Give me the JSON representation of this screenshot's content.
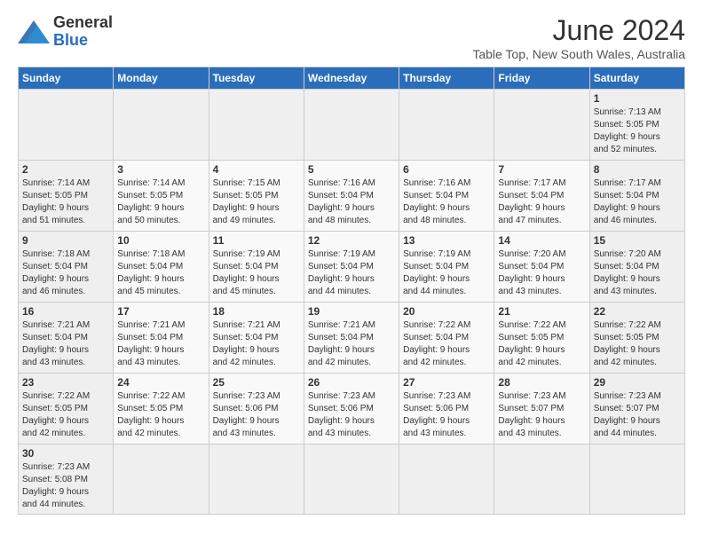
{
  "header": {
    "logo_general": "General",
    "logo_blue": "Blue",
    "month": "June 2024",
    "location": "Table Top, New South Wales, Australia"
  },
  "days_of_week": [
    "Sunday",
    "Monday",
    "Tuesday",
    "Wednesday",
    "Thursday",
    "Friday",
    "Saturday"
  ],
  "weeks": [
    [
      {
        "day": "",
        "info": ""
      },
      {
        "day": "",
        "info": ""
      },
      {
        "day": "",
        "info": ""
      },
      {
        "day": "",
        "info": ""
      },
      {
        "day": "",
        "info": ""
      },
      {
        "day": "",
        "info": ""
      },
      {
        "day": "1",
        "info": "Sunrise: 7:13 AM\nSunset: 5:05 PM\nDaylight: 9 hours\nand 52 minutes."
      }
    ],
    [
      {
        "day": "2",
        "info": "Sunrise: 7:14 AM\nSunset: 5:05 PM\nDaylight: 9 hours\nand 51 minutes."
      },
      {
        "day": "3",
        "info": "Sunrise: 7:14 AM\nSunset: 5:05 PM\nDaylight: 9 hours\nand 50 minutes."
      },
      {
        "day": "4",
        "info": "Sunrise: 7:15 AM\nSunset: 5:05 PM\nDaylight: 9 hours\nand 49 minutes."
      },
      {
        "day": "5",
        "info": "Sunrise: 7:16 AM\nSunset: 5:04 PM\nDaylight: 9 hours\nand 48 minutes."
      },
      {
        "day": "6",
        "info": "Sunrise: 7:16 AM\nSunset: 5:04 PM\nDaylight: 9 hours\nand 48 minutes."
      },
      {
        "day": "7",
        "info": "Sunrise: 7:17 AM\nSunset: 5:04 PM\nDaylight: 9 hours\nand 47 minutes."
      },
      {
        "day": "8",
        "info": "Sunrise: 7:17 AM\nSunset: 5:04 PM\nDaylight: 9 hours\nand 46 minutes."
      }
    ],
    [
      {
        "day": "9",
        "info": "Sunrise: 7:18 AM\nSunset: 5:04 PM\nDaylight: 9 hours\nand 46 minutes."
      },
      {
        "day": "10",
        "info": "Sunrise: 7:18 AM\nSunset: 5:04 PM\nDaylight: 9 hours\nand 45 minutes."
      },
      {
        "day": "11",
        "info": "Sunrise: 7:19 AM\nSunset: 5:04 PM\nDaylight: 9 hours\nand 45 minutes."
      },
      {
        "day": "12",
        "info": "Sunrise: 7:19 AM\nSunset: 5:04 PM\nDaylight: 9 hours\nand 44 minutes."
      },
      {
        "day": "13",
        "info": "Sunrise: 7:19 AM\nSunset: 5:04 PM\nDaylight: 9 hours\nand 44 minutes."
      },
      {
        "day": "14",
        "info": "Sunrise: 7:20 AM\nSunset: 5:04 PM\nDaylight: 9 hours\nand 43 minutes."
      },
      {
        "day": "15",
        "info": "Sunrise: 7:20 AM\nSunset: 5:04 PM\nDaylight: 9 hours\nand 43 minutes."
      }
    ],
    [
      {
        "day": "16",
        "info": "Sunrise: 7:21 AM\nSunset: 5:04 PM\nDaylight: 9 hours\nand 43 minutes."
      },
      {
        "day": "17",
        "info": "Sunrise: 7:21 AM\nSunset: 5:04 PM\nDaylight: 9 hours\nand 43 minutes."
      },
      {
        "day": "18",
        "info": "Sunrise: 7:21 AM\nSunset: 5:04 PM\nDaylight: 9 hours\nand 42 minutes."
      },
      {
        "day": "19",
        "info": "Sunrise: 7:21 AM\nSunset: 5:04 PM\nDaylight: 9 hours\nand 42 minutes."
      },
      {
        "day": "20",
        "info": "Sunrise: 7:22 AM\nSunset: 5:04 PM\nDaylight: 9 hours\nand 42 minutes."
      },
      {
        "day": "21",
        "info": "Sunrise: 7:22 AM\nSunset: 5:05 PM\nDaylight: 9 hours\nand 42 minutes."
      },
      {
        "day": "22",
        "info": "Sunrise: 7:22 AM\nSunset: 5:05 PM\nDaylight: 9 hours\nand 42 minutes."
      }
    ],
    [
      {
        "day": "23",
        "info": "Sunrise: 7:22 AM\nSunset: 5:05 PM\nDaylight: 9 hours\nand 42 minutes."
      },
      {
        "day": "24",
        "info": "Sunrise: 7:22 AM\nSunset: 5:05 PM\nDaylight: 9 hours\nand 42 minutes."
      },
      {
        "day": "25",
        "info": "Sunrise: 7:23 AM\nSunset: 5:06 PM\nDaylight: 9 hours\nand 43 minutes."
      },
      {
        "day": "26",
        "info": "Sunrise: 7:23 AM\nSunset: 5:06 PM\nDaylight: 9 hours\nand 43 minutes."
      },
      {
        "day": "27",
        "info": "Sunrise: 7:23 AM\nSunset: 5:06 PM\nDaylight: 9 hours\nand 43 minutes."
      },
      {
        "day": "28",
        "info": "Sunrise: 7:23 AM\nSunset: 5:07 PM\nDaylight: 9 hours\nand 43 minutes."
      },
      {
        "day": "29",
        "info": "Sunrise: 7:23 AM\nSunset: 5:07 PM\nDaylight: 9 hours\nand 44 minutes."
      }
    ],
    [
      {
        "day": "30",
        "info": "Sunrise: 7:23 AM\nSunset: 5:08 PM\nDaylight: 9 hours\nand 44 minutes."
      },
      {
        "day": "",
        "info": ""
      },
      {
        "day": "",
        "info": ""
      },
      {
        "day": "",
        "info": ""
      },
      {
        "day": "",
        "info": ""
      },
      {
        "day": "",
        "info": ""
      },
      {
        "day": "",
        "info": ""
      }
    ]
  ]
}
